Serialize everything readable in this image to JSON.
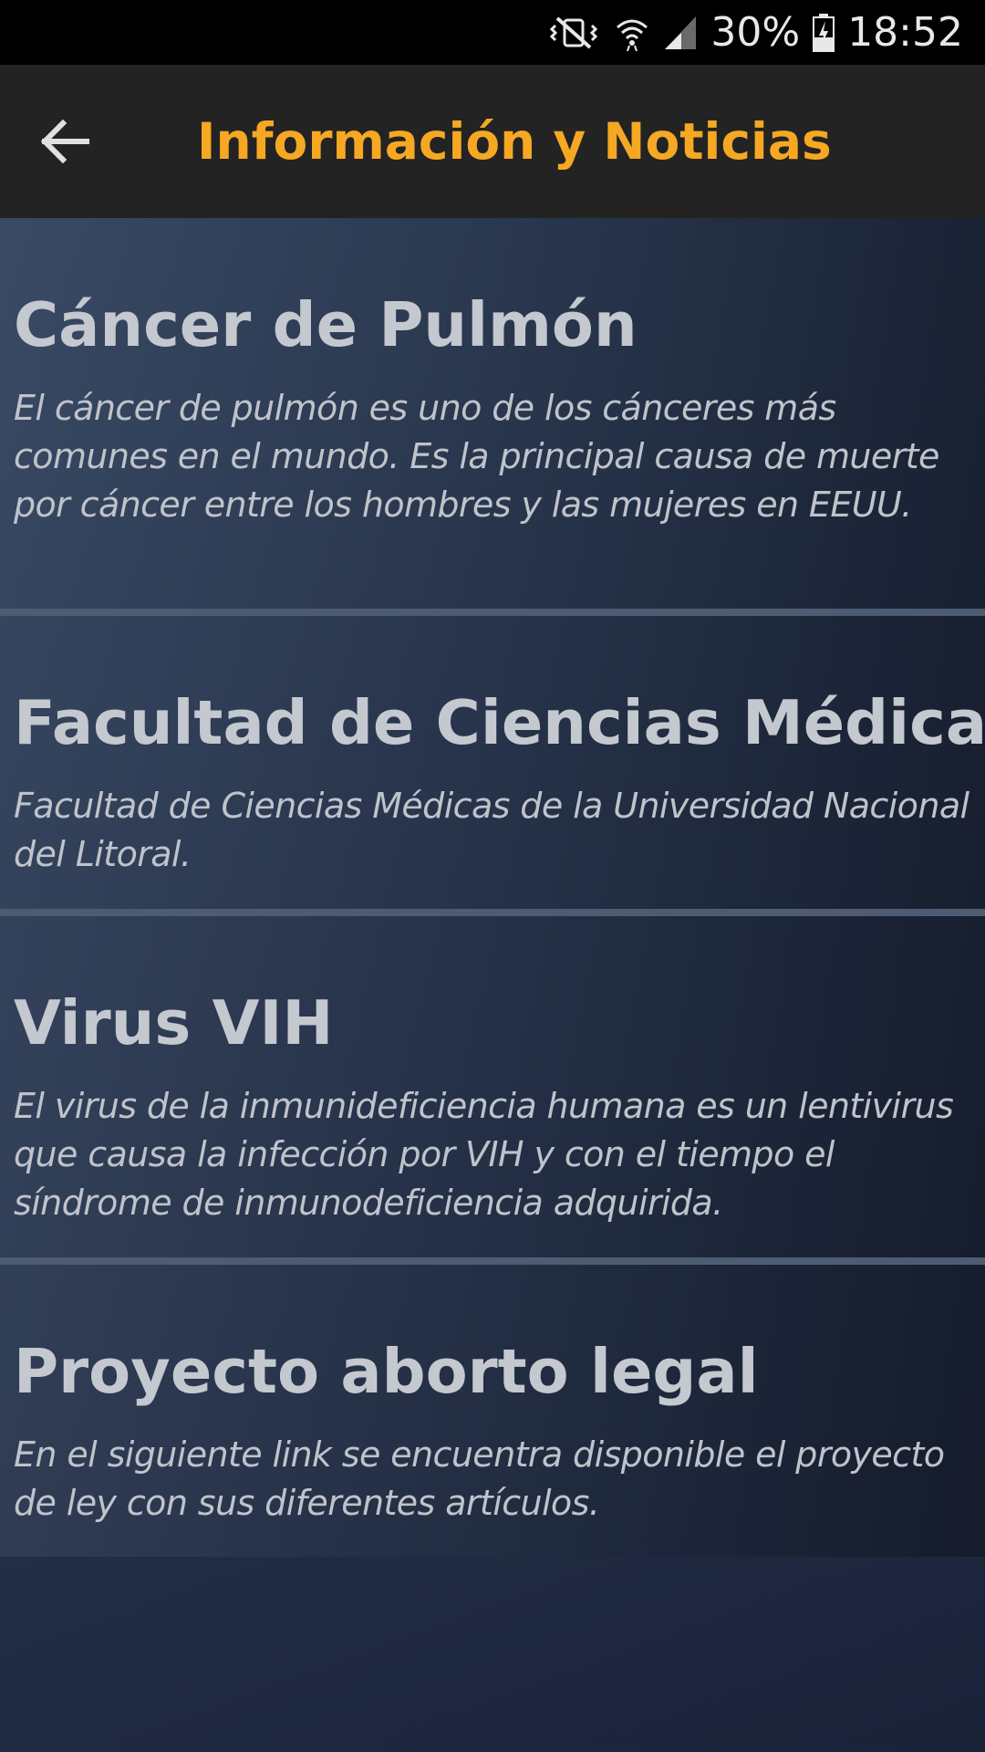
{
  "status_bar": {
    "battery_percent": "30%",
    "time": "18:52",
    "icons": [
      "mute-vibrate-icon",
      "wifi-icon",
      "signal-icon",
      "battery-charging-icon"
    ]
  },
  "app_bar": {
    "title": "Información y Noticias",
    "back_icon": "arrow-back-icon",
    "title_color": "#f6a823"
  },
  "items": [
    {
      "title": "Cáncer de Pulmón",
      "description": "El cáncer de pulmón es uno de los cánceres más comunes en el mundo. Es la principal causa de muerte por cáncer entre los hombres y las mujeres en EEUU."
    },
    {
      "title": "Facultad de Ciencias Médicas",
      "description": "Facultad de Ciencias Médicas de la Universidad Nacional del Litoral."
    },
    {
      "title": "Virus VIH",
      "description": "El virus de la inmunideficiencia humana es un lentivirus que causa la infección por VIH y con el tiempo el síndrome de inmunodeficiencia adquirida."
    },
    {
      "title": "Proyecto aborto legal",
      "description": "En el siguiente link se encuentra disponible el proyecto de ley con sus diferentes artículos."
    }
  ]
}
